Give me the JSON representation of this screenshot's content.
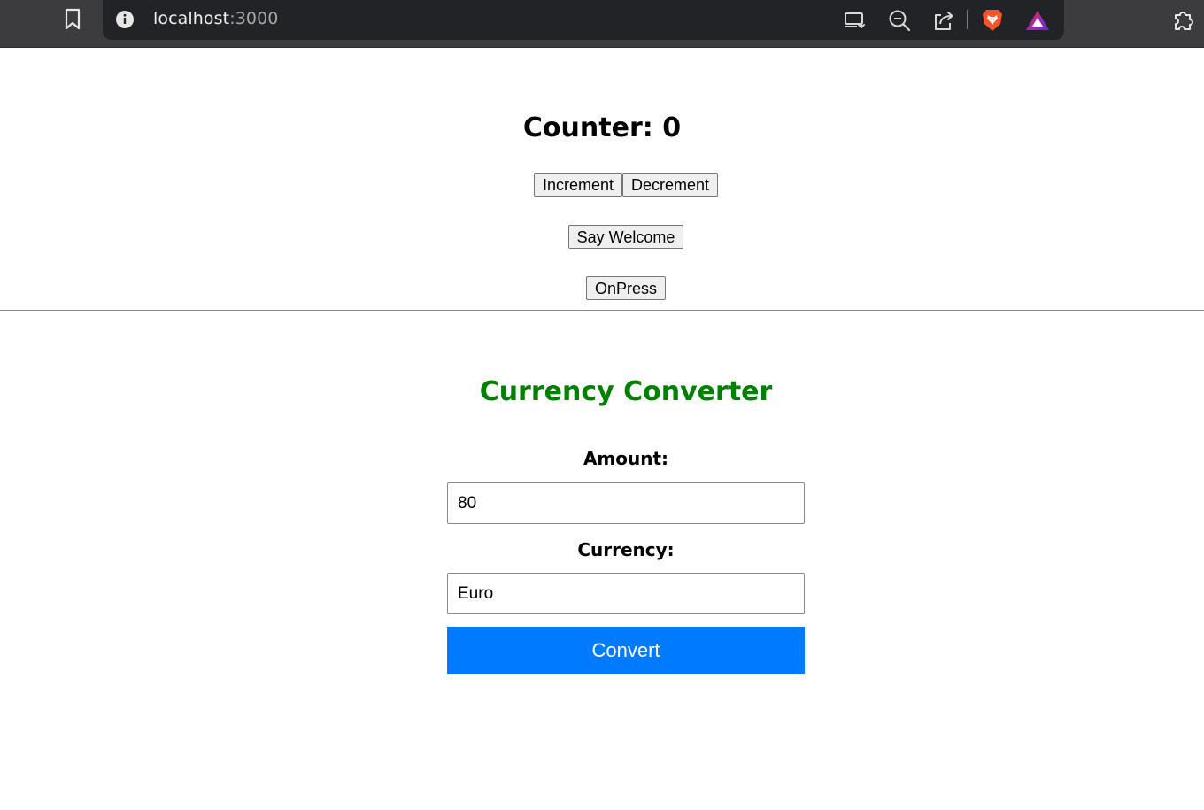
{
  "browser": {
    "url_host": "localhost",
    "url_port": ":3000",
    "icons": {
      "bookmark": "bookmark-icon",
      "site_info": "info-icon",
      "install": "install-app-icon",
      "zoom": "zoom-out-icon",
      "share": "share-icon",
      "brave": "brave-shields-icon",
      "rewards": "brave-rewards-icon",
      "extensions": "extensions-puzzle-icon"
    }
  },
  "counter": {
    "title": "Counter: 0",
    "increment_label": "Increment",
    "decrement_label": "Decrement",
    "welcome_label": "Say Welcome",
    "onpress_label": "OnPress"
  },
  "converter": {
    "title": "Currency Converter",
    "amount_label": "Amount:",
    "amount_value": "80",
    "currency_label": "Currency:",
    "currency_value": "Euro",
    "convert_label": "Convert"
  },
  "colors": {
    "title_green": "#008000",
    "convert_blue": "#007bff",
    "chrome_dark": "#3c3c3f",
    "omnibox_dark": "#222326"
  }
}
